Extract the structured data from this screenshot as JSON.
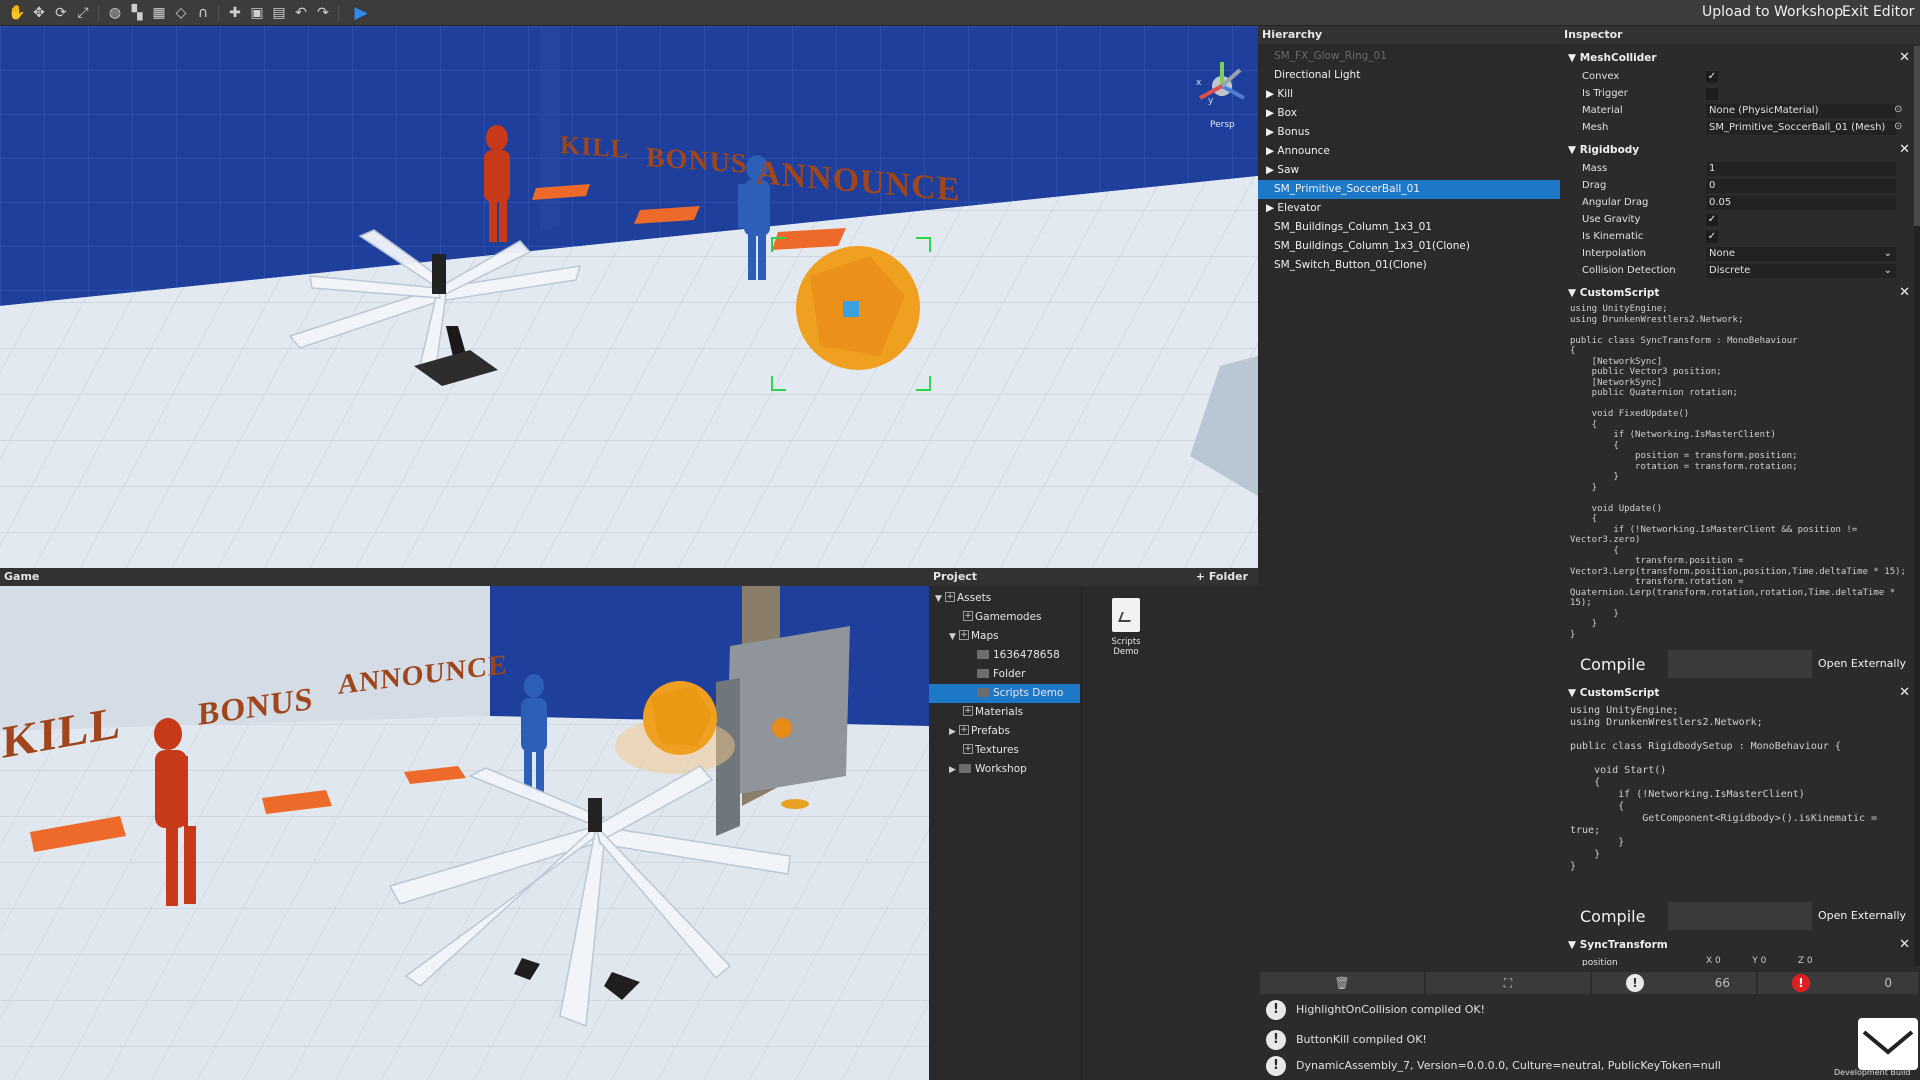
{
  "toolbar": {
    "icons": [
      "hand-icon",
      "move-icon",
      "rotate-icon",
      "scale-icon",
      "globe-icon",
      "snap-icon",
      "grid-icon",
      "pivot-icon",
      "magnet-icon",
      "add-icon",
      "save-icon",
      "save-as-icon",
      "undo-icon",
      "redo-icon",
      "play-icon"
    ],
    "upload_label": "Upload to Workshop",
    "exit_label": "Exit Editor"
  },
  "scene": {
    "gizmo_label": "Persp",
    "gizmo_axes": {
      "x": "x",
      "y": "y"
    },
    "world_text": [
      "KILL",
      "BONUS",
      "ANNOUNCE"
    ]
  },
  "game": {
    "title": "Game"
  },
  "project": {
    "title": "Project",
    "add_folder_label": "+ Folder",
    "tree": [
      {
        "label": "Assets"
      },
      {
        "label": "Gamemodes"
      },
      {
        "label": "Maps"
      },
      {
        "label": "1636478658"
      },
      {
        "label": "Folder"
      },
      {
        "label": "Scripts Demo"
      },
      {
        "label": "Materials"
      },
      {
        "label": "Prefabs"
      },
      {
        "label": "Textures"
      },
      {
        "label": "Workshop"
      }
    ],
    "file_tile": {
      "line1": "Scripts",
      "line2": "Demo"
    }
  },
  "hierarchy": {
    "title": "Hierarchy",
    "items": [
      {
        "label": "SM_FX_Glow_Ring_01"
      },
      {
        "label": "Directional Light"
      },
      {
        "label": "Kill"
      },
      {
        "label": "Box"
      },
      {
        "label": "Bonus"
      },
      {
        "label": "Announce"
      },
      {
        "label": "Saw"
      },
      {
        "label": "SM_Primitive_SoccerBall_01"
      },
      {
        "label": "Elevator"
      },
      {
        "label": "SM_Buildings_Column_1x3_01"
      },
      {
        "label": "SM_Buildings_Column_1x3_01(Clone)"
      },
      {
        "label": "SM_Switch_Button_01(Clone)"
      }
    ]
  },
  "inspector": {
    "title": "Inspector",
    "mesh_collider": {
      "title": "MeshCollider",
      "convex_label": "Convex",
      "convex": "✓",
      "is_trigger_label": "Is Trigger",
      "material_label": "Material",
      "material_value": "None (PhysicMaterial)",
      "mesh_label": "Mesh",
      "mesh_value": "SM_Primitive_SoccerBall_01 (Mesh)"
    },
    "rigidbody": {
      "title": "Rigidbody",
      "mass_label": "Mass",
      "mass": "1",
      "drag_label": "Drag",
      "drag": "0",
      "angular_drag_label": "Angular Drag",
      "angular_drag": "0.05",
      "use_gravity_label": "Use Gravity",
      "use_gravity": "✓",
      "is_kinematic_label": "Is Kinematic",
      "is_kinematic": "✓",
      "interpolation_label": "Interpolation",
      "interpolation": "None",
      "collision_label": "Collision Detection",
      "collision": "Discrete"
    },
    "custom_script_1": {
      "title": "CustomScript",
      "code": "using UnityEngine;\nusing DrunkenWrestlers2.Network;\n\npublic class SyncTransform : MonoBehaviour\n{\n    [NetworkSync]\n    public Vector3 position;\n    [NetworkSync]\n    public Quaternion rotation;\n\n    void FixedUpdate()\n    {\n        if (Networking.IsMasterClient)\n        {\n            position = transform.position;\n            rotation = transform.rotation;\n        }\n    }\n\n    void Update()\n    {\n        if (!Networking.IsMasterClient && position !=\nVector3.zero)\n        {\n            transform.position =\nVector3.Lerp(transform.position,position,Time.deltaTime * 15);\n            transform.rotation =\nQuaternion.Lerp(transform.rotation,rotation,Time.deltaTime *\n15);\n        }\n    }\n}",
      "compile_label": "Compile",
      "open_label": "Open Externally"
    },
    "custom_script_2": {
      "title": "CustomScript",
      "code": "using UnityEngine;\nusing DrunkenWrestlers2.Network;\n\npublic class RigidbodySetup : MonoBehaviour {\n\n    void Start()\n    {\n        if (!Networking.IsMasterClient)\n        {\n            GetComponent<Rigidbody>().isKinematic =\ntrue;\n        }\n    }\n}",
      "compile_label": "Compile",
      "open_label": "Open Externally"
    },
    "sync_transform": {
      "title": "SyncTransform",
      "field_label": "position",
      "x_label": "X",
      "x": "0",
      "y_label": "Y",
      "y": "0",
      "z_label": "Z",
      "z": "0"
    }
  },
  "console": {
    "warn_count": "66",
    "error_count": "0",
    "messages": [
      {
        "text": "HighlightOnCollision compiled OK!"
      },
      {
        "text": "ButtonKill compiled OK!"
      },
      {
        "text": "DynamicAssembly_7, Version=0.0.0.0, Culture=neutral, PublicKeyToken=null"
      }
    ],
    "dev_build_label": "Development Build"
  },
  "colors": {
    "selection": "#1e78c8",
    "wall_blue": "#1f3f9c",
    "floor": "#e3e9f0",
    "orange": "#e8802a",
    "red_figure": "#c63a1a",
    "blue_figure": "#2e5fb8",
    "ball": "#f0a020"
  }
}
